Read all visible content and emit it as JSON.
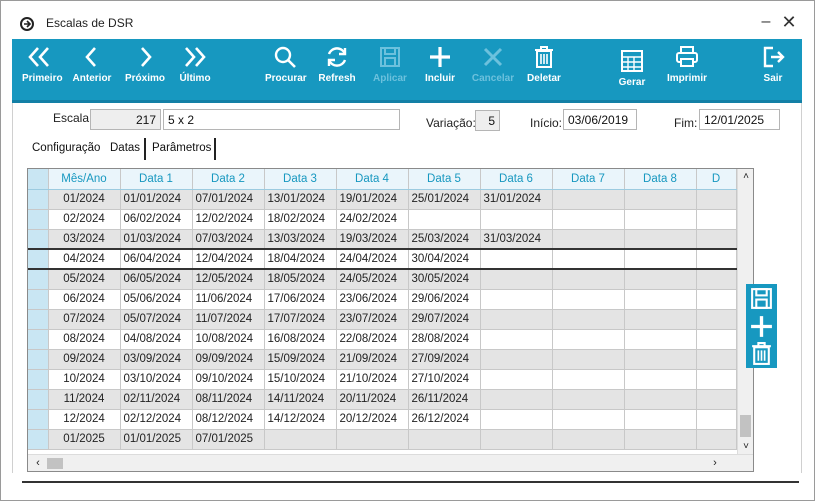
{
  "window": {
    "title": "Escalas de DSR",
    "minimize": "–",
    "close": "✕"
  },
  "toolbar": {
    "buttons": [
      {
        "label": "Primeiro",
        "icon": "double-chevron-left-icon",
        "enabled": true
      },
      {
        "label": "Anterior",
        "icon": "chevron-left-icon",
        "enabled": true
      },
      {
        "label": "Próximo",
        "icon": "chevron-right-icon",
        "enabled": true
      },
      {
        "label": "Último",
        "icon": "double-chevron-right-icon",
        "enabled": true
      },
      {
        "label": "Procurar",
        "icon": "search-icon",
        "enabled": true
      },
      {
        "label": "Refresh",
        "icon": "refresh-icon",
        "enabled": true
      },
      {
        "label": "Aplicar",
        "icon": "save-icon",
        "enabled": false
      },
      {
        "label": "Incluir",
        "icon": "plus-icon",
        "enabled": true
      },
      {
        "label": "Cancelar",
        "icon": "cancel-icon",
        "enabled": false
      },
      {
        "label": "Deletar",
        "icon": "trash-icon",
        "enabled": true
      },
      {
        "label": "Gerar",
        "icon": "calculator-icon",
        "enabled": true
      },
      {
        "label": "Imprimir",
        "icon": "printer-icon",
        "enabled": true
      },
      {
        "label": "Sair",
        "icon": "exit-icon",
        "enabled": true
      }
    ],
    "color": "#1798c0"
  },
  "form": {
    "escala_label": "Escala:",
    "escala_code": "217",
    "escala_name": "5 x 2",
    "variacao_label": "Variação:",
    "variacao_value": "5",
    "inicio_label": "Início:",
    "inicio_value": "03/06/2019",
    "fim_label": "Fim:",
    "fim_value": "12/01/2025"
  },
  "tabs": [
    {
      "label": "Configuração"
    },
    {
      "label": "Datas"
    },
    {
      "label": "Parâmetros"
    }
  ],
  "grid": {
    "columns": [
      "Mês/Ano",
      "Data 1",
      "Data 2",
      "Data 3",
      "Data 4",
      "Data 5",
      "Data 6",
      "Data 7",
      "Data 8",
      "D"
    ],
    "rows": [
      [
        "01/2024",
        "01/01/2024",
        "07/01/2024",
        "13/01/2024",
        "19/01/2024",
        "25/01/2024",
        "31/01/2024",
        "",
        "",
        ""
      ],
      [
        "02/2024",
        "06/02/2024",
        "12/02/2024",
        "18/02/2024",
        "24/02/2024",
        "",
        "",
        "",
        "",
        ""
      ],
      [
        "03/2024",
        "01/03/2024",
        "07/03/2024",
        "13/03/2024",
        "19/03/2024",
        "25/03/2024",
        "31/03/2024",
        "",
        "",
        ""
      ],
      [
        "04/2024",
        "06/04/2024",
        "12/04/2024",
        "18/04/2024",
        "24/04/2024",
        "30/04/2024",
        "",
        "",
        "",
        ""
      ],
      [
        "05/2024",
        "06/05/2024",
        "12/05/2024",
        "18/05/2024",
        "24/05/2024",
        "30/05/2024",
        "",
        "",
        "",
        ""
      ],
      [
        "06/2024",
        "05/06/2024",
        "11/06/2024",
        "17/06/2024",
        "23/06/2024",
        "29/06/2024",
        "",
        "",
        "",
        ""
      ],
      [
        "07/2024",
        "05/07/2024",
        "11/07/2024",
        "17/07/2024",
        "23/07/2024",
        "29/07/2024",
        "",
        "",
        "",
        ""
      ],
      [
        "08/2024",
        "04/08/2024",
        "10/08/2024",
        "16/08/2024",
        "22/08/2024",
        "28/08/2024",
        "",
        "",
        "",
        ""
      ],
      [
        "09/2024",
        "03/09/2024",
        "09/09/2024",
        "15/09/2024",
        "21/09/2024",
        "27/09/2024",
        "",
        "",
        "",
        ""
      ],
      [
        "10/2024",
        "03/10/2024",
        "09/10/2024",
        "15/10/2024",
        "21/10/2024",
        "27/10/2024",
        "",
        "",
        "",
        ""
      ],
      [
        "11/2024",
        "02/11/2024",
        "08/11/2024",
        "14/11/2024",
        "20/11/2024",
        "26/11/2024",
        "",
        "",
        "",
        ""
      ],
      [
        "12/2024",
        "02/12/2024",
        "08/12/2024",
        "14/12/2024",
        "20/12/2024",
        "26/12/2024",
        "",
        "",
        "",
        ""
      ],
      [
        "01/2025",
        "01/01/2025",
        "07/01/2025",
        "",
        "",
        "",
        "",
        "",
        "",
        ""
      ]
    ],
    "selected_row": 3
  },
  "side_actions": [
    {
      "icon": "save-icon"
    },
    {
      "icon": "plus-icon"
    },
    {
      "icon": "trash-icon"
    }
  ]
}
